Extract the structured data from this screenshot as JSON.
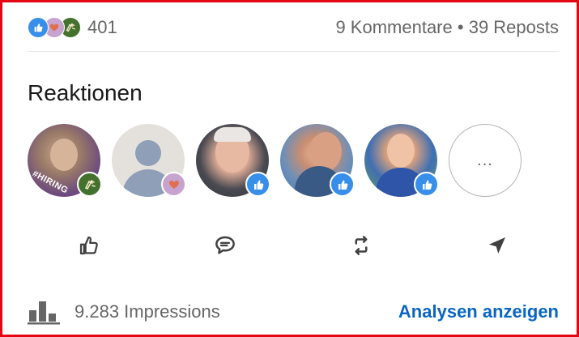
{
  "social_counts": {
    "reactions_total": "401",
    "comments": "9 Kommentare",
    "separator": "•",
    "reposts": "39 Reposts",
    "reaction_types": [
      "like-icon",
      "love-icon",
      "celebrate-icon"
    ]
  },
  "reactions_section": {
    "title": "Reaktionen",
    "avatars": [
      {
        "overlay_text": "#HIRING",
        "reaction": "celebrate"
      },
      {
        "overlay_text": "",
        "reaction": "love"
      },
      {
        "overlay_text": "",
        "reaction": "like"
      },
      {
        "overlay_text": "",
        "reaction": "like"
      },
      {
        "overlay_text": "",
        "reaction": "like"
      }
    ],
    "more_label": "..."
  },
  "actions": [
    "like-icon",
    "comment-icon",
    "repost-icon",
    "send-icon"
  ],
  "impressions": {
    "text": "9.283 Impressions",
    "link_label": "Analysen anzeigen"
  },
  "colors": {
    "border": "#e30613",
    "like": "#378fe9",
    "love": "#c7a3cf",
    "celebrate": "#44712e",
    "link": "#0a66c2",
    "muted_text": "#666666"
  }
}
